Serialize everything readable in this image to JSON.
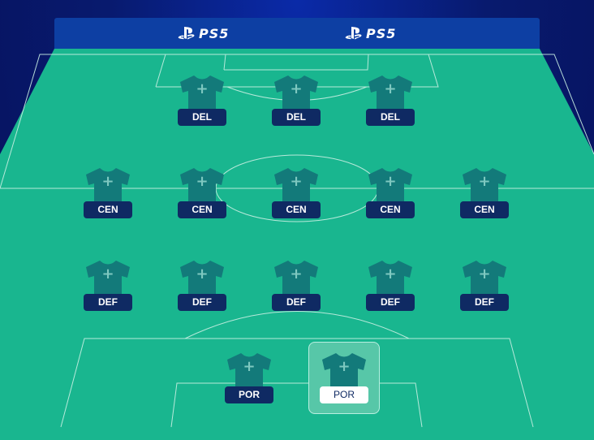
{
  "banner": {
    "logos": [
      "PS5",
      "PS5"
    ]
  },
  "colors": {
    "pitch": "#19b68f",
    "pitch_line": "#c9efe3",
    "shirt": "#137a7a",
    "label_bg": "#0f2a63",
    "selected_slot": "#57c7a8"
  },
  "formation": {
    "forwards": [
      {
        "label": "DEL",
        "icon": "plus-icon"
      },
      {
        "label": "DEL",
        "icon": "plus-icon"
      },
      {
        "label": "DEL",
        "icon": "plus-icon"
      }
    ],
    "midfielders": [
      {
        "label": "CEN",
        "icon": "plus-icon"
      },
      {
        "label": "CEN",
        "icon": "plus-icon"
      },
      {
        "label": "CEN",
        "icon": "plus-icon"
      },
      {
        "label": "CEN",
        "icon": "plus-icon"
      },
      {
        "label": "CEN",
        "icon": "plus-icon"
      }
    ],
    "defenders": [
      {
        "label": "DEF",
        "icon": "plus-icon"
      },
      {
        "label": "DEF",
        "icon": "plus-icon"
      },
      {
        "label": "DEF",
        "icon": "plus-icon"
      },
      {
        "label": "DEF",
        "icon": "plus-icon"
      },
      {
        "label": "DEF",
        "icon": "plus-icon"
      }
    ],
    "goalkeepers": [
      {
        "label": "POR",
        "icon": "plus-icon",
        "selected": false
      },
      {
        "label": "POR",
        "icon": "plus-icon",
        "selected": true
      }
    ]
  }
}
